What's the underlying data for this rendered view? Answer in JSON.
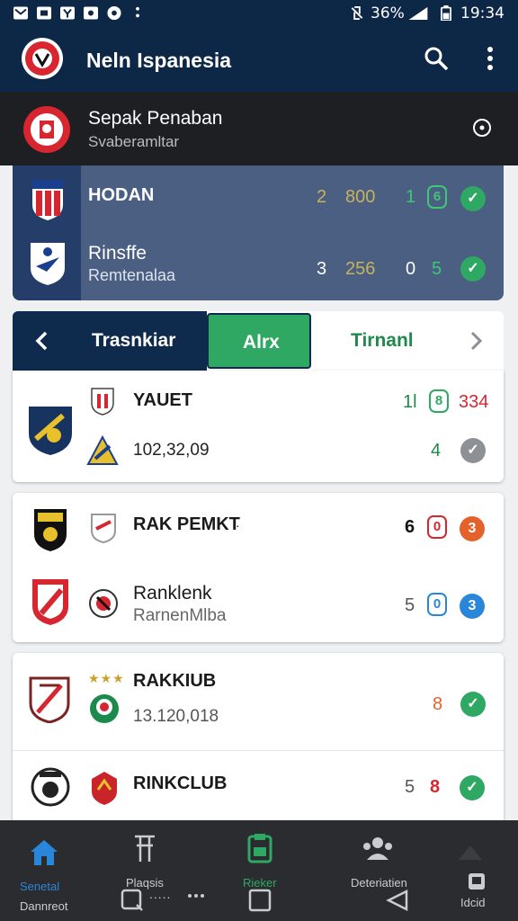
{
  "status_bar": {
    "battery": "36%",
    "time": "19:34"
  },
  "app_bar": {
    "title": "Neln Ispanesia"
  },
  "featured": {
    "title": "Sepak Penaban",
    "subtitle": "Svaberamltar"
  },
  "live": {
    "rows": [
      {
        "name": "HODAN",
        "subtitle": "",
        "a": "2",
        "b": "800",
        "c": "1",
        "d": "6"
      },
      {
        "name": "Rinsffe",
        "subtitle": "Remtenalaa",
        "a": "3",
        "b": "256",
        "c": "0",
        "d": "5"
      }
    ]
  },
  "tabs": {
    "left": "Trasnkiar",
    "active": "Alrx",
    "right": "Tirnanl"
  },
  "card1": {
    "rows": [
      {
        "name": "YAUET",
        "n1": "1l",
        "pill": "8",
        "n2": "334"
      },
      {
        "name": "102,32,09",
        "n1": "4"
      }
    ]
  },
  "card2": {
    "rows": [
      {
        "name": "RAK PEMKT",
        "n1": "6",
        "pill": "0",
        "dot": "3"
      },
      {
        "name": "Ranklenk",
        "subtitle": "RarnenMlba",
        "n1": "5",
        "pill": "0",
        "dot": "3"
      }
    ]
  },
  "card3": {
    "rows": [
      {
        "name": "RAKKIUB",
        "subtitle": "13.120,018",
        "n1": "8"
      },
      {
        "name": "RINKCLUB",
        "n1": "5",
        "n2": "8"
      }
    ],
    "stars": "★★★"
  },
  "bottom_nav": {
    "items": [
      "Senetal",
      "Plaqsis",
      "Rieker",
      "Deteriatien",
      ""
    ],
    "extra_left": "Dannreot",
    "extra_right": "Idcid",
    "dots": "....."
  },
  "colors": {
    "primary": "#0d2746",
    "green": "#2fa864",
    "red": "#d7262f",
    "orange": "#e5612c",
    "blue": "#2a86d8"
  }
}
